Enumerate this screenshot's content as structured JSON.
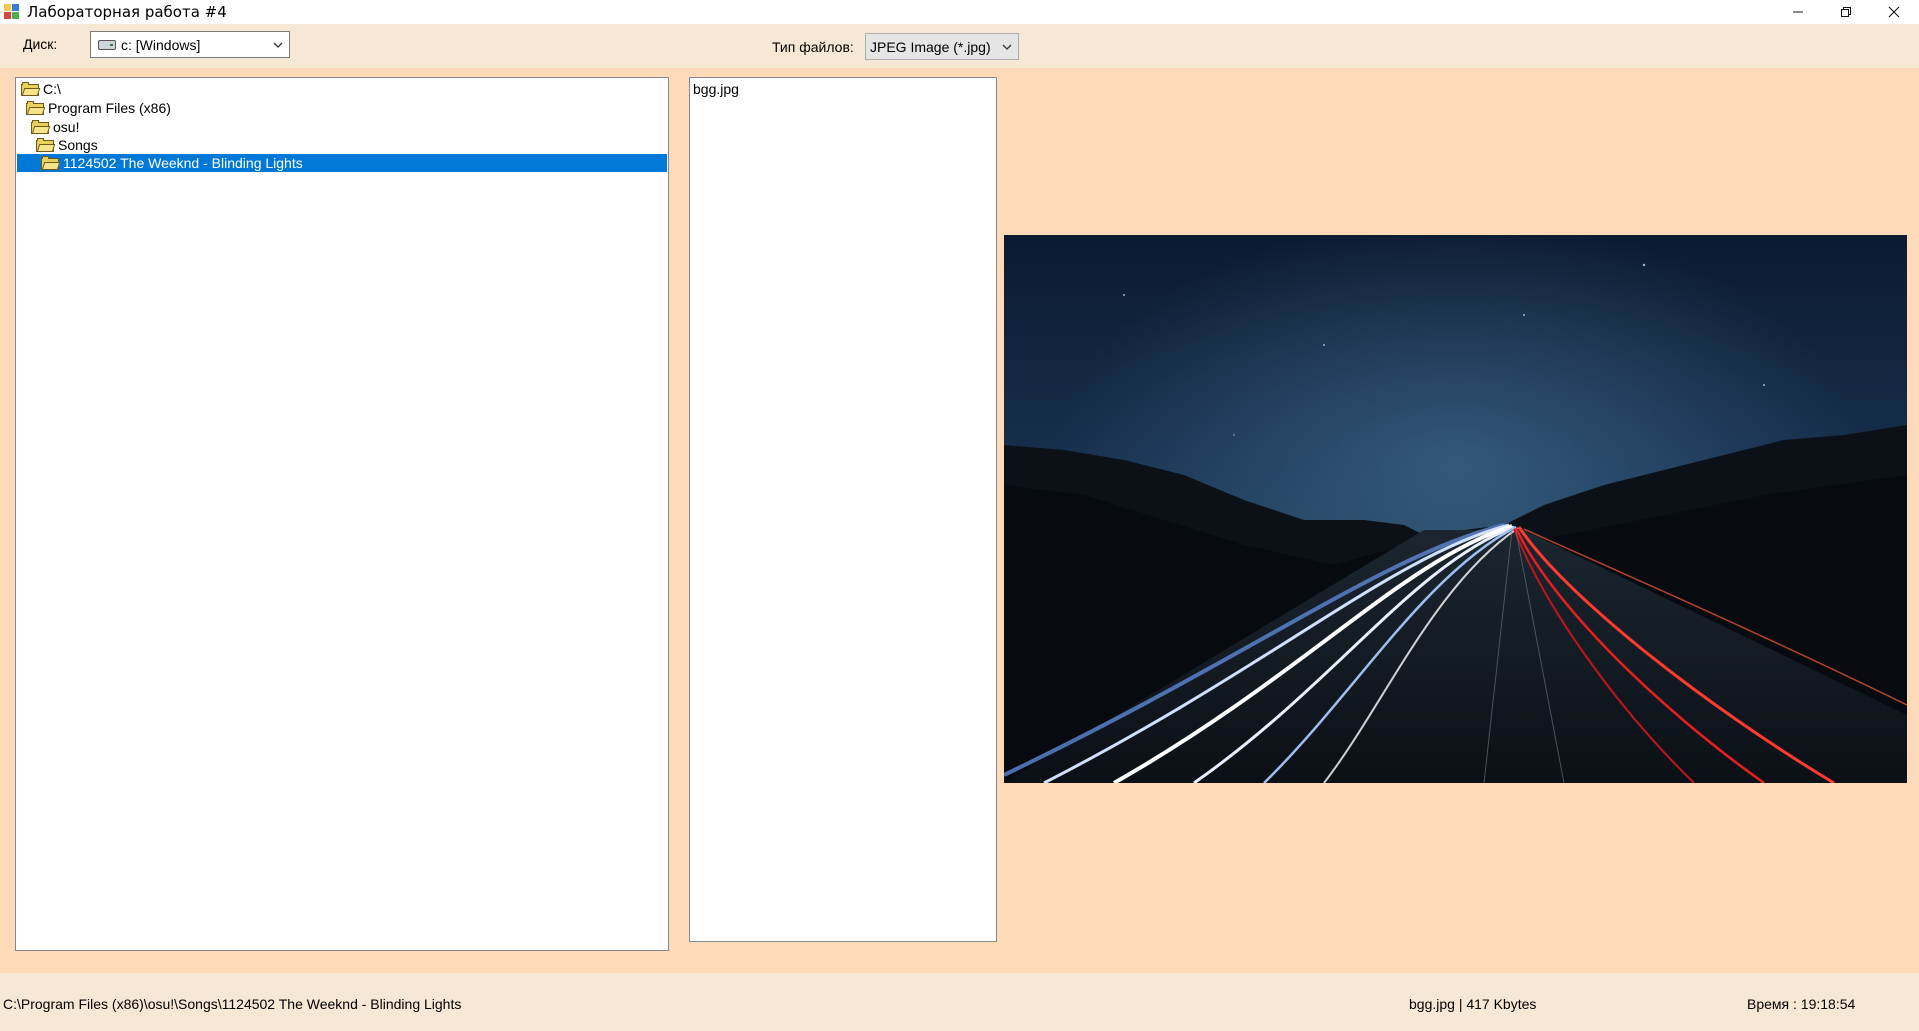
{
  "window": {
    "title": "Лабораторная работа #4",
    "minimize_icon": "minimize-icon",
    "restore_icon": "restore-icon",
    "close_icon": "close-icon"
  },
  "toolbar": {
    "drive_label": "Диск:",
    "drive_value": "c: [Windows]",
    "filetype_label": "Тип файлов:",
    "filetype_value": "JPEG Image  (*.jpg)"
  },
  "tree": {
    "items": [
      {
        "label": "C:\\",
        "level": 0,
        "selected": false
      },
      {
        "label": "Program Files (x86)",
        "level": 1,
        "selected": false
      },
      {
        "label": "osu!",
        "level": 2,
        "selected": false
      },
      {
        "label": "Songs",
        "level": 3,
        "selected": false
      },
      {
        "label": "1124502 The Weeknd - Blinding Lights",
        "level": 4,
        "selected": true
      }
    ]
  },
  "files": {
    "items": [
      "bgg.jpg"
    ]
  },
  "preview": {
    "description_icon": "image-preview"
  },
  "status": {
    "path": "C:\\Program Files (x86)\\osu!\\Songs\\1124502 The Weeknd - Blinding Lights",
    "file_info": "bgg.jpg  |  417 Kbytes",
    "time": "Время :  19:18:54"
  },
  "colors": {
    "background": "#ffdab9",
    "selection": "#0078d7"
  }
}
